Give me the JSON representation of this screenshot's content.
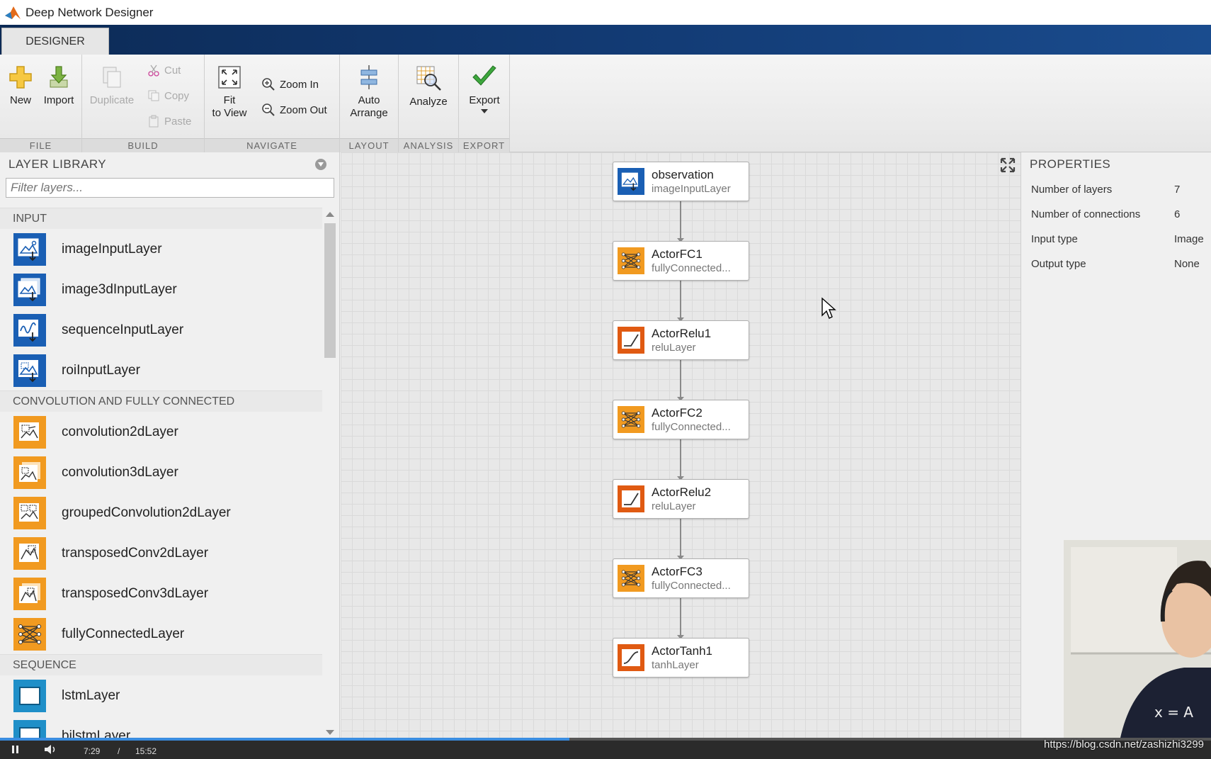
{
  "window": {
    "title": "Deep Network Designer"
  },
  "tabs": [
    {
      "label": "DESIGNER"
    }
  ],
  "ribbon": {
    "file": {
      "title": "FILE",
      "new_label": "New",
      "import_label": "Import"
    },
    "build": {
      "title": "BUILD",
      "duplicate_label": "Duplicate",
      "cut_label": "Cut",
      "copy_label": "Copy",
      "paste_label": "Paste"
    },
    "navigate": {
      "title": "NAVIGATE",
      "fit_label_1": "Fit",
      "fit_label_2": "to View",
      "zoom_in_label": "Zoom In",
      "zoom_out_label": "Zoom Out"
    },
    "layout": {
      "title": "LAYOUT",
      "auto_label_1": "Auto",
      "auto_label_2": "Arrange"
    },
    "analysis": {
      "title": "ANALYSIS",
      "analyze_label": "Analyze"
    },
    "export": {
      "title": "EXPORT",
      "export_label": "Export"
    }
  },
  "library": {
    "title": "LAYER LIBRARY",
    "filter_placeholder": "Filter layers...",
    "categories": [
      {
        "name": "INPUT",
        "items": [
          "imageInputLayer",
          "image3dInputLayer",
          "sequenceInputLayer",
          "roiInputLayer"
        ]
      },
      {
        "name": "CONVOLUTION AND FULLY CONNECTED",
        "items": [
          "convolution2dLayer",
          "convolution3dLayer",
          "groupedConvolution2dLayer",
          "transposedConv2dLayer",
          "transposedConv3dLayer",
          "fullyConnectedLayer"
        ]
      },
      {
        "name": "SEQUENCE",
        "items": [
          "lstmLayer",
          "bilstmLayer"
        ]
      }
    ]
  },
  "network": {
    "nodes": [
      {
        "name": "observation",
        "type": "imageInputLayer",
        "icon": "image-input-icon"
      },
      {
        "name": "ActorFC1",
        "type": "fullyConnected...",
        "icon": "fully-connected-icon"
      },
      {
        "name": "ActorRelu1",
        "type": "reluLayer",
        "icon": "relu-icon"
      },
      {
        "name": "ActorFC2",
        "type": "fullyConnected...",
        "icon": "fully-connected-icon"
      },
      {
        "name": "ActorRelu2",
        "type": "reluLayer",
        "icon": "relu-icon"
      },
      {
        "name": "ActorFC3",
        "type": "fullyConnected...",
        "icon": "fully-connected-icon"
      },
      {
        "name": "ActorTanh1",
        "type": "tanhLayer",
        "icon": "tanh-icon"
      }
    ]
  },
  "properties": {
    "title": "PROPERTIES",
    "rows": [
      {
        "label": "Number of layers",
        "value": "7"
      },
      {
        "label": "Number of connections",
        "value": "6"
      },
      {
        "label": "Input type",
        "value": "Image"
      },
      {
        "label": "Output type",
        "value": "None"
      }
    ]
  },
  "video": {
    "current_time": "7:29",
    "separator": "/",
    "total_time": "15:52",
    "progress": 0.47
  },
  "watermark": "https://blog.csdn.net/zashizhi3299",
  "colors": {
    "input_blue": "#1a5fb4",
    "conv_orange": "#f19a20",
    "relu_red": "#e05a12",
    "tab_blue": "#123a73"
  }
}
